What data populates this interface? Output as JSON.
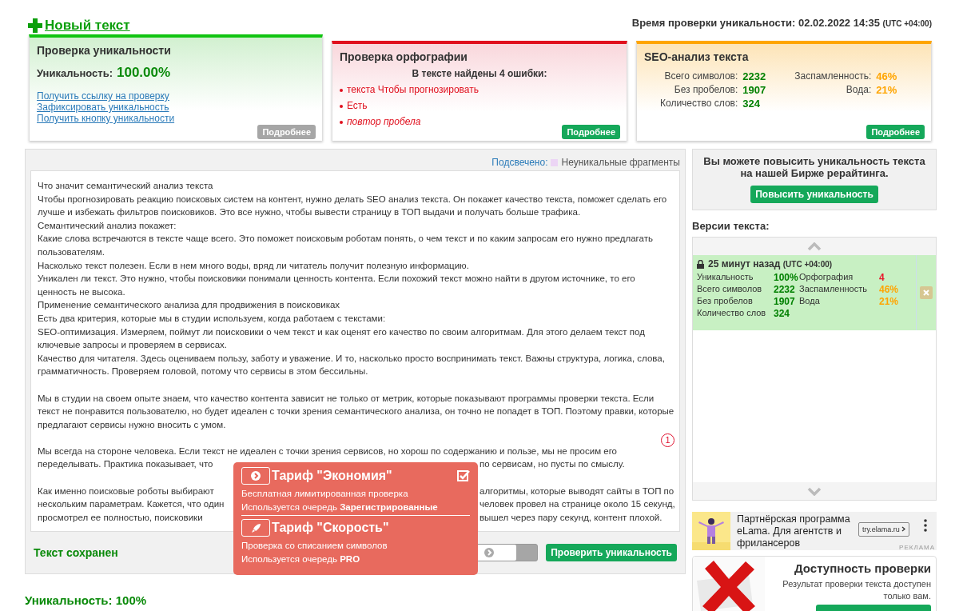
{
  "new_text_link": "Новый текст",
  "check_time": {
    "label": "Время проверки уникальности:",
    "value": "02.02.2022 14:35",
    "tz": "(UTC +04:00)"
  },
  "cards": [
    {
      "kind": "uniqueness",
      "title": "Проверка уникальности",
      "label": "Уникальность:",
      "value": "100.00%",
      "links": [
        "Получить ссылку на проверку",
        "Зафиксировать уникальность",
        "Получить кнопку уникальности"
      ],
      "button": "Подробнее",
      "disabled": true
    },
    {
      "kind": "spelling",
      "title": "Проверка орфографии",
      "summary": "В тексте найдены 4 ошибки:",
      "errors": [
        {
          "text": "текста Чтобы прогнозировать",
          "italic": false
        },
        {
          "text": "Есть",
          "italic": false
        },
        {
          "text": "повтор пробела",
          "italic": true
        }
      ],
      "button": "Подробнее",
      "disabled": false
    },
    {
      "kind": "seo",
      "title": "SEO-анализ текста",
      "stats": [
        {
          "label": "Всего символов:",
          "value": "2232",
          "color": "#008000"
        },
        {
          "label": "Заспамленность:",
          "value": "46%",
          "color": "#ffa500"
        },
        {
          "label": "Без пробелов:",
          "value": "1907",
          "color": "#008000"
        },
        {
          "label": "Вода:",
          "value": "21%",
          "color": "#ffa500"
        },
        {
          "label": "Количество слов:",
          "value": "324",
          "color": "#008000"
        }
      ],
      "button": "Подробнее",
      "disabled": false
    }
  ],
  "legend": {
    "label": "Подсвечено:",
    "item": "Неуникальные фрагменты"
  },
  "editor": {
    "blocks": [
      [
        {
          "kind": "full",
          "text": "Что значит семантический анализ текста"
        },
        {
          "kind": "full",
          "text": "Чтобы прогнозировать реакцию поисковых систем на контент, нужно делать SEO анализ текста. Он покажет качество текста, поможет сделать его"
        },
        {
          "kind": "full",
          "text": "лучше и избежать фильтров поисковиков. Это все нужно, чтобы вывести страницу в ТОП выдачи и получать больше трафика."
        },
        {
          "kind": "full",
          "text": "Семантический анализ покажет:"
        },
        {
          "kind": "full",
          "text": "Какие слова встречаются в тексте чаще всего. Это поможет поисковым роботам понять, о чем текст и по каким запросам его нужно предлагать"
        },
        {
          "kind": "full",
          "text": "пользователям."
        },
        {
          "kind": "full",
          "text": "Насколько текст полезен. Если в нем много воды, вряд ли читатель получит полезную информацию."
        },
        {
          "kind": "full",
          "text": "Уникален ли текст. Это нужно, чтобы поисковики понимали ценность контента. Если похожий текст можно найти в другом источнике, то его"
        },
        {
          "kind": "full",
          "text": "ценность не высока."
        },
        {
          "kind": "full",
          "text": "Применение семантического анализа для продвижения в поисковиках"
        },
        {
          "kind": "full",
          "text": "Есть два критерия, которые мы в студии используем, когда работаем с текстами:"
        },
        {
          "kind": "full",
          "text": "SEO-оптимизация. Измеряем, поймут ли поисковики о чем текст и как оценят его качество по своим алгоритмам. Для этого делаем текст под"
        },
        {
          "kind": "full",
          "text": "ключевые запросы и проверяем в сервисах."
        },
        {
          "kind": "full",
          "text": "Качество для читателя. Здесь оцениваем пользу, заботу и уважение. И то, насколько просто воспринимать текст. Важны структура, логика, слова,"
        },
        {
          "kind": "full",
          "text": "грамматичность. Проверяем головой, потому что сервисы в этом  бессильны."
        }
      ],
      [
        {
          "kind": "full",
          "text": "Мы в студии на своем опыте знаем, что качество контента зависит не только от метрик, которые показывают программы проверки текста. Если"
        },
        {
          "kind": "full",
          "text": "текст не понравится пользователю, но будет идеален с точки зрения семантического анализа, он точно не попадет в ТОП. Поэтому правки, которые"
        },
        {
          "kind": "full",
          "text": "предлагают сервисы нужно вносить с умом."
        }
      ],
      [
        {
          "kind": "full",
          "text": "Мы всегда на стороне человека. Если текст не идеален с точки зрения сервисов, но хорош по содержанию и пользе, мы не просим его"
        },
        {
          "kind": "covered",
          "left": "переделывать. Практика показывает, что",
          "right": "по сервисам, но пусты по смыслу."
        }
      ],
      [
        {
          "kind": "covered",
          "left": "Как именно поисковые роботы выбирают",
          "right": "алгоритмы, которые выводят сайты в ТОП по"
        },
        {
          "kind": "covered",
          "left": "нескольким параметрам. Кажется, что один",
          "right": "человек провел на странице около 15 секунд,"
        },
        {
          "kind": "covered",
          "left": "просмотрел ее полностью, поисковики",
          "right": "вышел через пару секунд, контент плохой."
        }
      ]
    ],
    "marker": "1"
  },
  "footer": {
    "status": "Текст сохранен",
    "toggle": {
      "on": false
    },
    "button": "Проверить уникальность"
  },
  "tariffs": [
    {
      "title": "Тариф \"Экономия\"",
      "selected": true,
      "lines": [
        "Бесплатная лимитированная проверка",
        "Используется очередь **Зарегистрированные**"
      ]
    },
    {
      "title": "Тариф \"Скорость\"",
      "selected": false,
      "lines": [
        "Проверка со списанием символов",
        "Используется очередь **PRO**"
      ]
    }
  ],
  "promo": {
    "text": "Вы можете повысить уникальность текста на нашей Бирже рерайтинга.",
    "button": "Повысить уникальность"
  },
  "versions": {
    "title": "Версии текста:",
    "items": [
      {
        "time": "25 минут назад",
        "tz": "(UTC +04:00)",
        "locked": true,
        "stats": [
          {
            "label": "Уникальность",
            "value": "100%",
            "color": "#008000"
          },
          {
            "label": "Орфография",
            "value": "4",
            "color": "#e8192c"
          },
          {
            "label": "Всего символов",
            "value": "2232",
            "color": "#008000"
          },
          {
            "label": "Заспамленность",
            "value": "46%",
            "color": "#ffa500"
          },
          {
            "label": "Без пробелов",
            "value": "1907",
            "color": "#008000"
          },
          {
            "label": "Вода",
            "value": "21%",
            "color": "#ffa500"
          },
          {
            "label": "Количество слов",
            "value": "324",
            "color": "#008000"
          }
        ]
      }
    ]
  },
  "ad": {
    "text": "Партнёрская программа eLama. Для агентств и фрилансеров",
    "url": "try.elama.ru",
    "label": "РЕКЛАМА"
  },
  "access": {
    "title": "Доступность проверки",
    "text": "Результат проверки текста доступен только вам."
  },
  "summary": "Уникальность: 100%"
}
